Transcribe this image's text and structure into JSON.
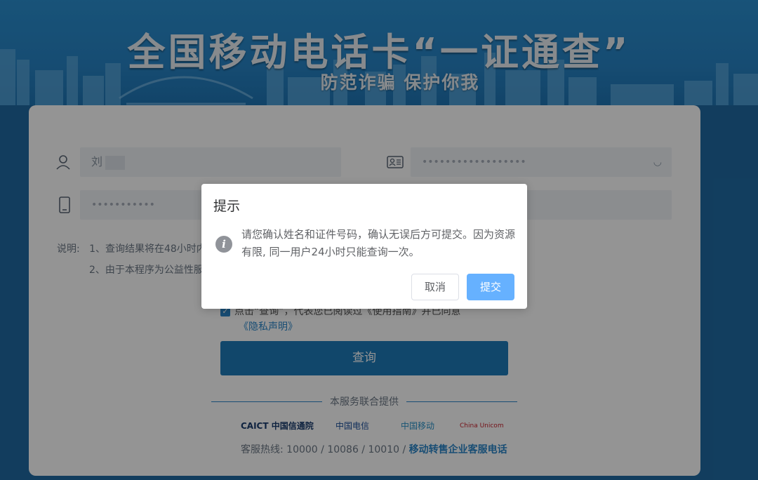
{
  "banner": {
    "title": "全国移动电话卡“一证通查”",
    "subtitle": "防范诈骗 保护你我"
  },
  "form": {
    "name_value": "刘",
    "id_placeholder": "••••••••••••••••••",
    "phone_placeholder": "•••••••••••"
  },
  "notes": {
    "label": "说明:",
    "line1": "1、查询结果将在48小时内",
    "line2": "2、由于本程序为公益性服"
  },
  "agreement": {
    "line1": "点击“查询”，代表您已阅读过《使用指南》并已同意",
    "line2": "《隐私声明》"
  },
  "query_button": "查询",
  "provider": {
    "label": "本服务联合提供",
    "logos": [
      "CAICT 中国信通院",
      "中国电信",
      "中国移动",
      "China Unicom"
    ]
  },
  "hotline": {
    "text": "客服热线: 10000 / 10086 / 10010 / ",
    "link": "移动转售企业客服电话"
  },
  "modal": {
    "title": "提示",
    "message": "请您确认姓名和证件号码，确认无误后方可提交。因为资源有限, 同一用户24小时只能查询一次。",
    "cancel": "取消",
    "submit": "提交"
  },
  "colors": {
    "banner": "#2784c6",
    "primary": "#1e7ab9",
    "submit": "#66b1ff"
  }
}
